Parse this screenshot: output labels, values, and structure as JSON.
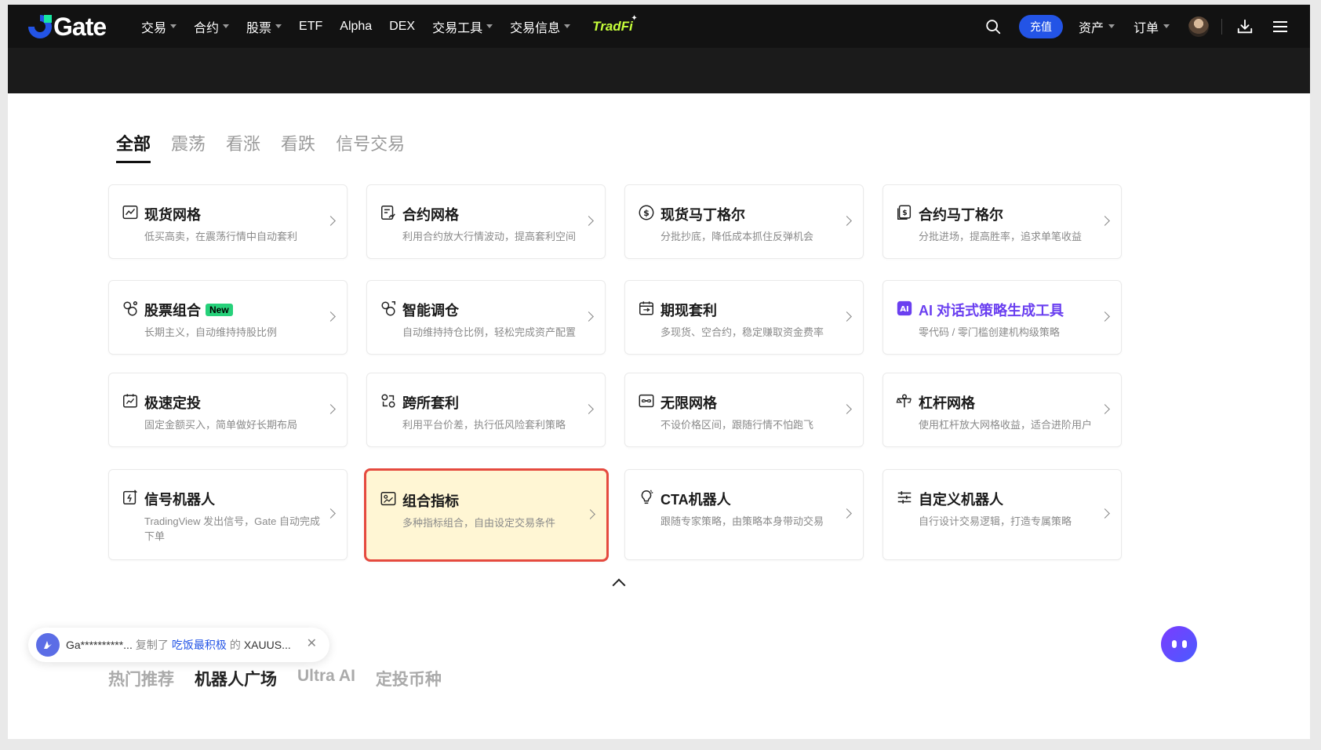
{
  "header": {
    "logo_text": "Gate",
    "nav": [
      {
        "label": "交易",
        "caret": true
      },
      {
        "label": "合约",
        "caret": true
      },
      {
        "label": "股票",
        "caret": true
      },
      {
        "label": "ETF",
        "caret": false
      },
      {
        "label": "Alpha",
        "caret": false
      },
      {
        "label": "DEX",
        "caret": false
      },
      {
        "label": "交易工具",
        "caret": true
      },
      {
        "label": "交易信息",
        "caret": true
      }
    ],
    "tradfi_label": "TradFi",
    "deposit_label": "充值",
    "assets_label": "资产",
    "orders_label": "订单"
  },
  "tabs": [
    {
      "label": "全部",
      "active": true
    },
    {
      "label": "震荡",
      "active": false
    },
    {
      "label": "看涨",
      "active": false
    },
    {
      "label": "看跌",
      "active": false
    },
    {
      "label": "信号交易",
      "active": false
    }
  ],
  "cards": [
    {
      "title": "现货网格",
      "desc": "低买高卖，在震荡行情中自动套利",
      "icon": "chart-grid-icon"
    },
    {
      "title": "合约网格",
      "desc": "利用合约放大行情波动，提高套利空间",
      "icon": "contract-grid-icon"
    },
    {
      "title": "现货马丁格尔",
      "desc": "分批抄底，降低成本抓住反弹机会",
      "icon": "dollar-circle-icon"
    },
    {
      "title": "合约马丁格尔",
      "desc": "分批进场，提高胜率，追求单笔收益",
      "icon": "dollar-doc-icon"
    },
    {
      "title": "股票组合",
      "desc": "长期主义，自动维持持股比例",
      "icon": "portfolio-icon",
      "badge": "New"
    },
    {
      "title": "智能调仓",
      "desc": "自动维持持仓比例，轻松完成资产配置",
      "icon": "rebalance-icon"
    },
    {
      "title": "期现套利",
      "desc": "多现货、空合约，稳定赚取资金费率",
      "icon": "calendar-arb-icon"
    },
    {
      "title": "AI 对话式策略生成工具",
      "desc": "零代码 / 零门槛创建机构级策略",
      "icon": "ai-icon",
      "ai": true
    },
    {
      "title": "极速定投",
      "desc": "固定金额买入，简单做好长期布局",
      "icon": "calendar-invest-icon"
    },
    {
      "title": "跨所套利",
      "desc": "利用平台价差，执行低风险套利策略",
      "icon": "cross-exchange-icon"
    },
    {
      "title": "无限网格",
      "desc": "不设价格区间，跟随行情不怕跑飞",
      "icon": "infinity-grid-icon"
    },
    {
      "title": "杠杆网格",
      "desc": "使用杠杆放大网格收益，适合进阶用户",
      "icon": "leverage-scale-icon"
    },
    {
      "title": "信号机器人",
      "desc": "TradingView 发出信号，Gate 自动完成下单",
      "icon": "signal-bot-icon"
    },
    {
      "title": "组合指标",
      "desc": "多种指标组合，自由设定交易条件",
      "icon": "indicator-icon",
      "highlight": true
    },
    {
      "title": "CTA机器人",
      "desc": "跟随专家策略，由策略本身带动交易",
      "icon": "bulb-icon"
    },
    {
      "title": "自定义机器人",
      "desc": "自行设计交易逻辑，打造专属策略",
      "icon": "sliders-icon"
    }
  ],
  "toast": {
    "user": "Ga**********...",
    "action": "复制了",
    "strategy": "吃饭最积极",
    "of": "的",
    "pair": "XAUUS..."
  },
  "bottom_tabs": [
    {
      "label": "热门推荐",
      "active": false
    },
    {
      "label": "机器人广场",
      "active": true
    },
    {
      "label": "Ultra AI",
      "active": false
    },
    {
      "label": "定投币种",
      "active": false
    }
  ],
  "colors": {
    "brand_blue": "#2354e6",
    "highlight_border": "#e54a3f",
    "highlight_bg": "#fff6d4",
    "new_badge": "#26d17a",
    "ai_purple": "#6a3ff0"
  }
}
